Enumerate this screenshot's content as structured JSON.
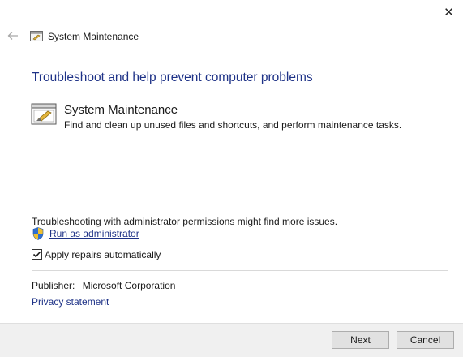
{
  "window": {
    "title": "System Maintenance",
    "close_icon": "close-icon",
    "back_icon": "back-arrow-icon"
  },
  "main": {
    "heading": "Troubleshoot and help prevent computer problems",
    "task": {
      "icon": "system-maintenance-icon",
      "title": "System Maintenance",
      "description": "Find and clean up unused files and shortcuts, and perform maintenance tasks."
    },
    "admin_note": "Troubleshooting with administrator permissions might find more issues.",
    "run_admin_link": "Run as administrator",
    "shield_icon": "uac-shield-icon",
    "apply_repairs": {
      "label": "Apply repairs automatically",
      "checked": true
    },
    "publisher_label": "Publisher:",
    "publisher_value": "Microsoft Corporation",
    "privacy_link": "Privacy statement"
  },
  "footer": {
    "next_label": "Next",
    "cancel_label": "Cancel"
  },
  "colors": {
    "heading": "#1e3287",
    "link": "#1e3287",
    "footer_bg": "#f0f0f0",
    "button_bg": "#e1e1e1"
  }
}
